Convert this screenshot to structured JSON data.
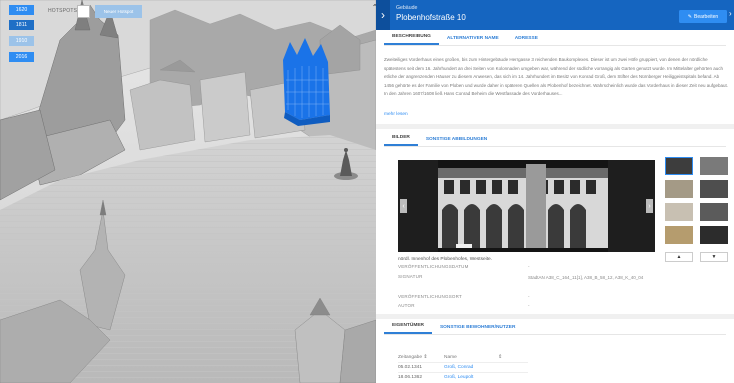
{
  "viewport": {
    "years": [
      {
        "label": "1620",
        "color": "#2f8df2"
      },
      {
        "label": "1811",
        "color": "#1f6fc6"
      },
      {
        "label": "1910",
        "color": "#9cc3e9"
      },
      {
        "label": "2016",
        "color": "#2f8df2"
      }
    ],
    "hotspots_label": "HOTSPOTS",
    "new_hotspot_label": "Neuer Hotspot"
  },
  "panel": {
    "type": "Gebäude",
    "name": "Plobenhofstraße 10",
    "edit_label": "Bearbeiten",
    "tabs": [
      "BESCHREIBUNG",
      "ALTERNATIVER NAME",
      "ADRESSE"
    ],
    "description": "Zweiteiliges Vorderhaus eines großen, bis zum Hintergebäude Herrgasse 3 reichenden Baukomplexes. Dieser ist um zwei Höfe gruppiert, von denen der nördliche spätestens seit dem 16. Jahrhundert an drei Seiten von Kolonnaden umgeben war, während der südliche vorrangig als Garten genutzt wurde. Im Mittelalter gehörten auch etliche der angrenzenden Häuser zu diesem Anwesen, das sich im 14. Jahrhundert im Besitz von Konrad Groß, dem Stifter des Nürnberger Heiliggeistspitals befand. Ab 1456 gehörte es der Familie von Ploben und wurde daher in späteren Quellen als Plobenhof bezeichnet. Wahrscheinlich wurde das Vorderhaus in dieser Zeit neu aufgebaut. In den Jahren 1607/1608 ließ Hans Conrad Beheim die Westfassade des Vorderhauses...",
    "more_label": "mehr lesen",
    "image_tabs": [
      "BILDER",
      "SONSTIGE ABBILDUNGEN"
    ],
    "image_caption": "Innenhof des Plobenhofes, Westseite.",
    "image_caption_prefix": "nördl. Innenhof des Plobenhofes, Westseite.",
    "metadata": [
      {
        "label": "VERÖFFENTLICHUNGSDATUM",
        "value": "-"
      },
      {
        "label": "SIGNATUR",
        "value": "StadtAN A38_C_164_11[1], A38_B_58_12, A38_K_40_04"
      },
      {
        "label": "VERÖFFENTLICHUNGSORT",
        "value": "-"
      },
      {
        "label": "AUTOR",
        "value": "-"
      }
    ],
    "owner_tabs": [
      "EIGENTÜMER",
      "SONSTIGE BEWOHNER/NUTZER"
    ],
    "owner_columns": [
      "Zeitangabe",
      "Name"
    ],
    "owners": [
      {
        "date": "05.02.1341",
        "name": "Groß, Conrad"
      },
      {
        "date": "18.06.1362",
        "name": "Groß, Leupolt"
      }
    ]
  }
}
